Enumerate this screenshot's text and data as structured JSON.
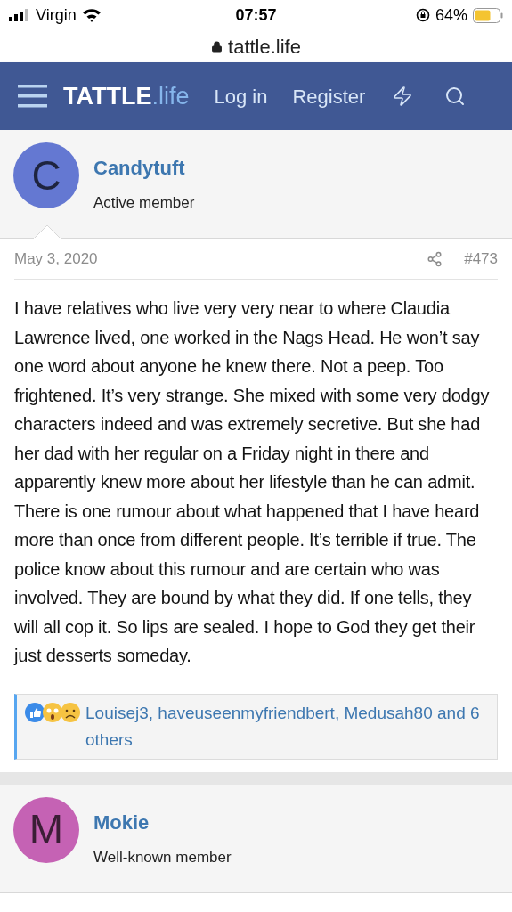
{
  "status_bar": {
    "carrier": "Virgin",
    "time": "07:57",
    "battery": "64%"
  },
  "address_bar": {
    "url": "tattle.life"
  },
  "nav": {
    "logo_main": "TATTLE",
    "logo_suffix": ".life",
    "links": [
      "Log in",
      "Register"
    ]
  },
  "posts": [
    {
      "avatar_letter": "C",
      "color": "#6478d2",
      "author": "Candytuft",
      "rank": "Active member",
      "date": "May 3, 2020",
      "number": "#473",
      "body": "I have relatives who live very very near to where Claudia Lawrence lived, one worked in the Nags Head. He won’t say one word about anyone he knew there. Not a peep. Too frightened. It’s very strange. She mixed with some very dodgy characters indeed and was extremely secretive. But she had her dad with her regular on a Friday night in there and apparently knew more about her lifestyle than he can admit. There is one rumour about what happened that I have heard more than once from different people. It’s terrible if true. The police know about this rumour and are certain who was involved. They are bound by what they did. If one tells, they will all cop it. So lips are sealed. I hope to God they get their just desserts someday.",
      "reactions": "Louisej3, haveuseenmyfriendbert, Medusah80 and 6 others"
    },
    {
      "avatar_letter": "M",
      "color": "#c562b4",
      "author": "Mokie",
      "rank": "Well-known member"
    }
  ]
}
